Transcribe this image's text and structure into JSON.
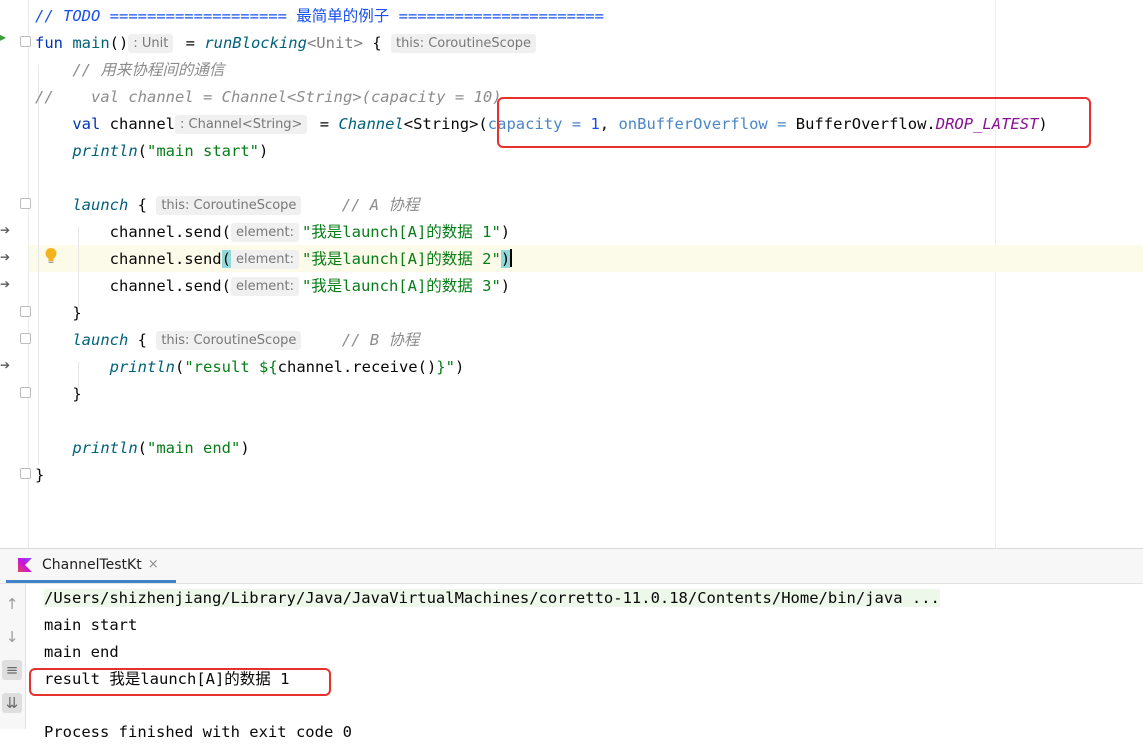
{
  "editor": {
    "lines": [
      {
        "segments": [
          {
            "cls": "cm",
            "text": "// TODO =================== "
          },
          {
            "cls": "cm-cn",
            "text": "最简单的例子"
          },
          {
            "cls": "cm",
            "text": " ======================"
          }
        ]
      },
      {
        "segments": [
          {
            "cls": "kw",
            "text": "fun "
          },
          {
            "cls": "fn",
            "text": "main"
          },
          {
            "cls": "",
            "text": "()"
          },
          {
            "cls": "hint",
            "text": ": Unit"
          },
          {
            "cls": "",
            "text": " = "
          },
          {
            "cls": "it",
            "text": "runBlocking"
          },
          {
            "cls": "ty",
            "text": "<Unit>"
          },
          {
            "cls": "",
            "text": " { "
          },
          {
            "cls": "hint",
            "text": "this: CoroutineScope"
          }
        ]
      },
      {
        "segments": [
          {
            "cls": "",
            "text": "    "
          },
          {
            "cls": "cm",
            "text": "// 用来协程间的通信"
          }
        ]
      },
      {
        "segments": [
          {
            "cls": "cm",
            "text": "//    val channel = Channel<String>(capacity = 10)"
          }
        ]
      },
      {
        "segments": [
          {
            "cls": "",
            "text": "    "
          },
          {
            "cls": "kw",
            "text": "val "
          },
          {
            "cls": "",
            "text": "channel"
          },
          {
            "cls": "hint",
            "text": ": Channel<String>"
          },
          {
            "cls": "",
            "text": " = "
          },
          {
            "cls": "it",
            "text": "Channel"
          },
          {
            "cls": "",
            "text": "<String>("
          },
          {
            "cls": "pm",
            "text": "capacity = "
          },
          {
            "cls": "num",
            "text": "1"
          },
          {
            "cls": "",
            "text": ", "
          },
          {
            "cls": "pm",
            "text": "onBufferOverflow = "
          },
          {
            "cls": "",
            "text": "BufferOverflow."
          },
          {
            "cls": "cst",
            "text": "DROP_LATEST"
          },
          {
            "cls": "",
            "text": ")"
          }
        ]
      },
      {
        "segments": [
          {
            "cls": "",
            "text": "    "
          },
          {
            "cls": "it",
            "text": "println"
          },
          {
            "cls": "",
            "text": "("
          },
          {
            "cls": "str",
            "text": "\"main start\""
          },
          {
            "cls": "",
            "text": ")"
          }
        ]
      },
      {
        "segments": []
      },
      {
        "segments": [
          {
            "cls": "",
            "text": "    "
          },
          {
            "cls": "it",
            "text": "launch"
          },
          {
            "cls": "",
            "text": " { "
          },
          {
            "cls": "hint",
            "text": "this: CoroutineScope"
          },
          {
            "cls": "",
            "text": "    "
          },
          {
            "cls": "cm",
            "text": "// A 协程"
          }
        ]
      },
      {
        "segments": [
          {
            "cls": "",
            "text": "        channel.send("
          },
          {
            "cls": "hint",
            "text": "element:"
          },
          {
            "cls": "str",
            "text": "\"我是launch[A]的数据 1\""
          },
          {
            "cls": "",
            "text": ")"
          }
        ]
      },
      {
        "segments": [
          {
            "cls": "",
            "text": "        channel.send"
          },
          {
            "cls": "brace-hl",
            "text": "("
          },
          {
            "cls": "hint",
            "text": "element:"
          },
          {
            "cls": "str",
            "text": "\"我是launch[A]的数据 2\""
          },
          {
            "cls": "brace-hl",
            "text": ")"
          }
        ]
      },
      {
        "segments": [
          {
            "cls": "",
            "text": "        channel.send("
          },
          {
            "cls": "hint",
            "text": "element:"
          },
          {
            "cls": "str",
            "text": "\"我是launch[A]的数据 3\""
          },
          {
            "cls": "",
            "text": ")"
          }
        ]
      },
      {
        "segments": [
          {
            "cls": "",
            "text": "    }"
          }
        ]
      },
      {
        "segments": [
          {
            "cls": "",
            "text": "    "
          },
          {
            "cls": "it",
            "text": "launch"
          },
          {
            "cls": "",
            "text": " { "
          },
          {
            "cls": "hint",
            "text": "this: CoroutineScope"
          },
          {
            "cls": "",
            "text": "    "
          },
          {
            "cls": "cm",
            "text": "// B 协程"
          }
        ]
      },
      {
        "segments": [
          {
            "cls": "",
            "text": "        "
          },
          {
            "cls": "it",
            "text": "println"
          },
          {
            "cls": "",
            "text": "("
          },
          {
            "cls": "str",
            "text": "\"result ${"
          },
          {
            "cls": "",
            "text": "channel.receive()"
          },
          {
            "cls": "str",
            "text": "}\""
          },
          {
            "cls": "",
            "text": ")"
          }
        ]
      },
      {
        "segments": [
          {
            "cls": "",
            "text": "    }"
          }
        ]
      },
      {
        "segments": []
      },
      {
        "segments": [
          {
            "cls": "",
            "text": "    "
          },
          {
            "cls": "it",
            "text": "println"
          },
          {
            "cls": "",
            "text": "("
          },
          {
            "cls": "str",
            "text": "\"main end\""
          },
          {
            "cls": "",
            "text": ")"
          }
        ]
      },
      {
        "segments": [
          {
            "cls": "",
            "text": "}"
          }
        ]
      }
    ]
  },
  "run_panel": {
    "tab_label": "ChannelTestKt",
    "tab_close": "×",
    "output_lines": [
      "/Users/shizhenjiang/Library/Java/JavaVirtualMachines/corretto-11.0.18/Contents/Home/bin/java ...",
      "main start",
      "main end",
      "result 我是launch[A]的数据 1",
      "Process finished with exit code 0"
    ]
  },
  "colors": {
    "highlight_box": "#e8302c",
    "keyword": "#0033b3",
    "string": "#067d17",
    "comment": "#8c8c8c"
  }
}
